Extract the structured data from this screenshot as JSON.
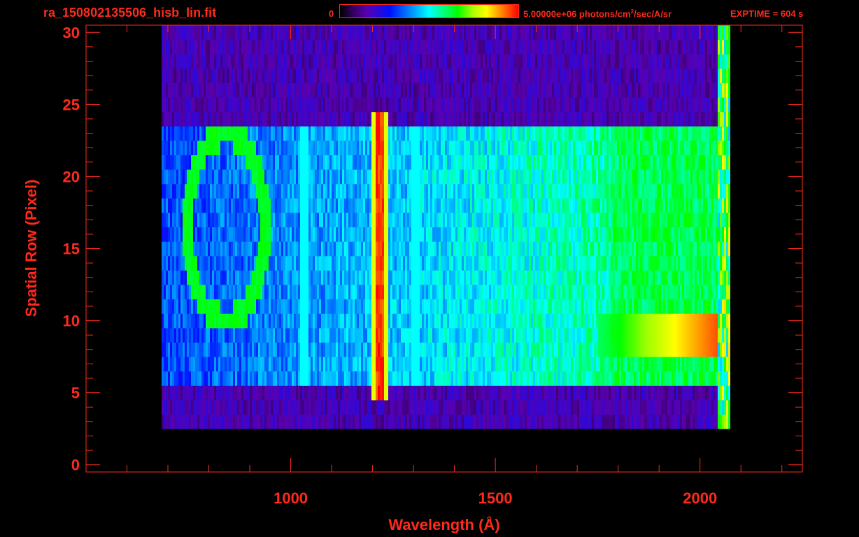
{
  "header": {
    "file_title": "ra_150802135506_hisb_lin.fit",
    "colorbar_min": "0",
    "colorbar_max_value": "5.00000e+06 photons/cm",
    "colorbar_max_exp": "2",
    "colorbar_max_unit": "/sec/A/sr",
    "exptime": "EXPTIME = 604 s"
  },
  "colors": {
    "axis": "#ff2a1a",
    "background": "#000000"
  },
  "chart_data": {
    "type": "heatmap",
    "title": "ra_150802135506_hisb_lin.fit",
    "xlabel": "Wavelength (Å)",
    "ylabel": "Spatial Row (Pixel)",
    "xlim": [
      500,
      2250
    ],
    "ylim": [
      -0.5,
      30.5
    ],
    "xticks": [
      1000,
      1500,
      2000
    ],
    "yticks": [
      0,
      5,
      10,
      15,
      20,
      25,
      30
    ],
    "colorbar": {
      "min": 0,
      "max": 5000000,
      "unit": "photons/cm^2/sec/A/sr"
    },
    "signal_extent": {
      "x": [
        680,
        2070
      ],
      "y": [
        3,
        30
      ]
    },
    "features": [
      {
        "name": "Lyman-alpha",
        "x": 1216,
        "rows": [
          5,
          24
        ],
        "level": 0.95
      },
      {
        "name": "bright rows",
        "x": [
          1750,
          2070
        ],
        "rows": [
          8,
          10
        ],
        "level": 0.9
      },
      {
        "name": "ring",
        "x": [
          760,
          920
        ],
        "rows": [
          10,
          23
        ],
        "level": 0.6
      }
    ]
  }
}
